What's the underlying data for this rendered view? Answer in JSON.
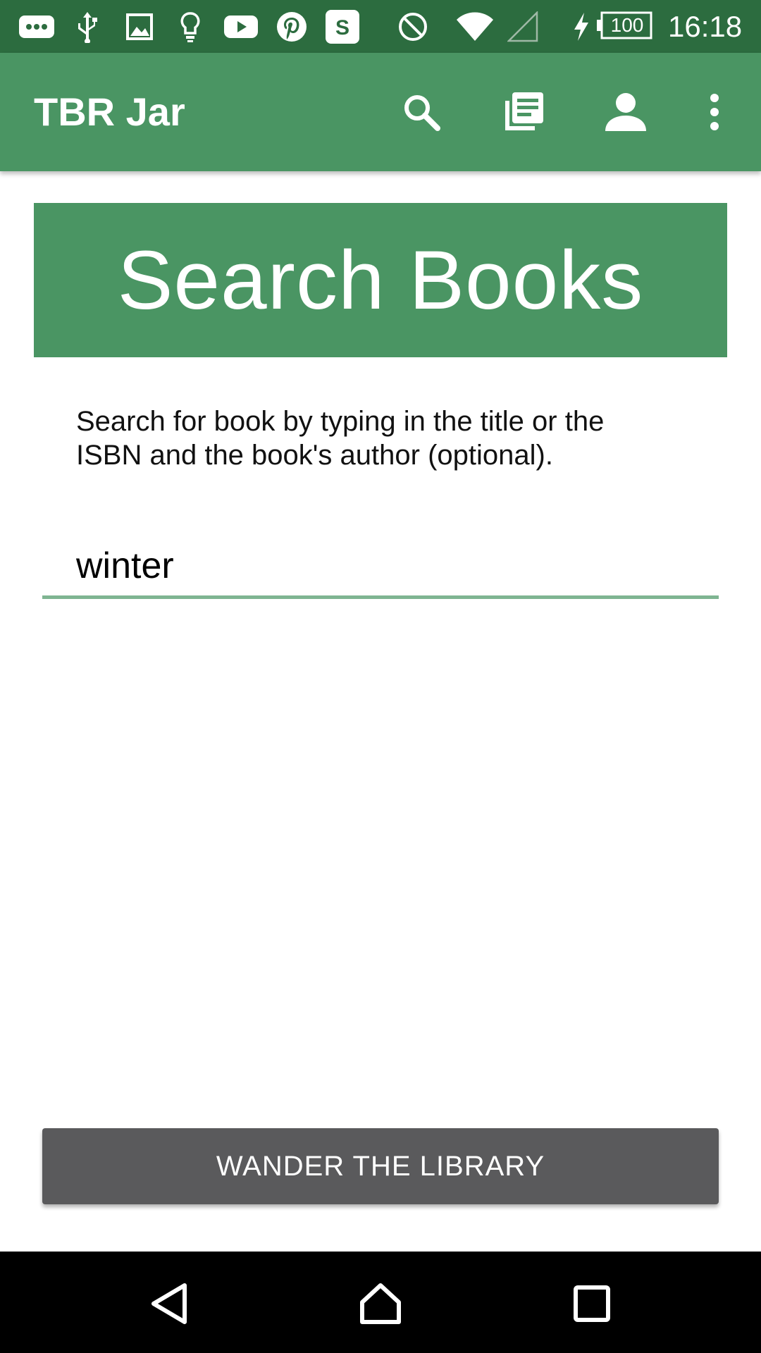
{
  "status_bar": {
    "battery": "100",
    "time": "16:18",
    "icons": [
      "messages-icon",
      "usb-icon",
      "image-icon",
      "lightbulb-icon",
      "youtube-icon",
      "pinterest-icon",
      "s-app-icon",
      "do-not-disturb-icon",
      "wifi-icon",
      "signal-icon",
      "charging-icon",
      "battery-icon"
    ],
    "s_app_letter": "S"
  },
  "app_bar": {
    "title": "TBR Jar",
    "actions": [
      "search-icon",
      "library-icon",
      "profile-icon",
      "more-vert-icon"
    ]
  },
  "banner": {
    "title": "Search Books"
  },
  "instructions": "Search for book by typing in the title or the ISBN and the book's author (optional).",
  "search": {
    "value": "winter"
  },
  "wander_button": {
    "label": "WANDER THE LIBRARY"
  },
  "nav_bar": {
    "buttons": [
      "back-icon",
      "home-icon",
      "recents-icon"
    ]
  },
  "colors": {
    "status_bar": "#2c6c3f",
    "primary": "#4a9563",
    "input_underline": "#7fb592",
    "button": "#5a5a5c"
  }
}
